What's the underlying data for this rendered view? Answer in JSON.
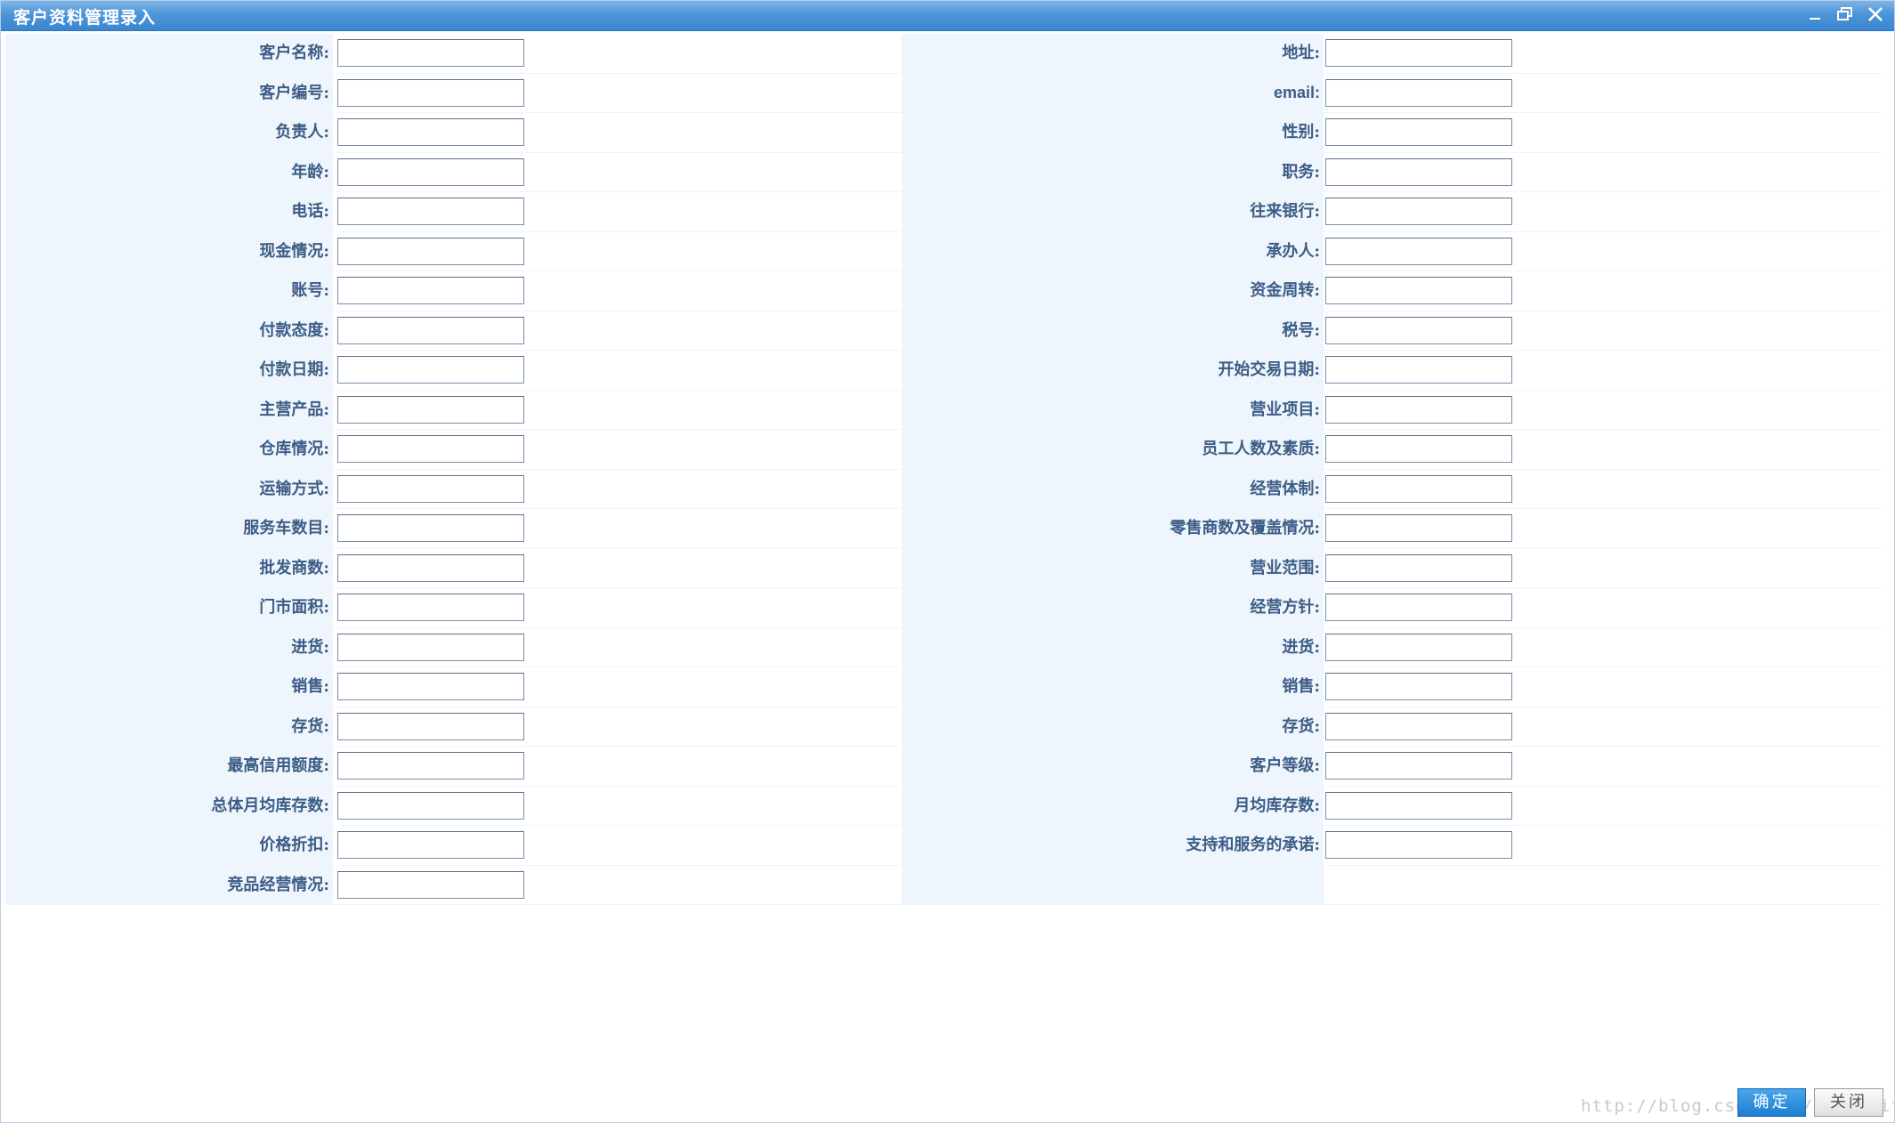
{
  "window": {
    "title": "客户资料管理录入",
    "minimize_icon": "minimize-icon",
    "restore_icon": "restore-icon",
    "close_icon": "close-icon"
  },
  "form": {
    "rows": [
      {
        "left": "客户名称:",
        "right": "地址:"
      },
      {
        "left": "客户编号:",
        "right": "email:"
      },
      {
        "left": "负责人:",
        "right": "性别:"
      },
      {
        "left": "年龄:",
        "right": "职务:"
      },
      {
        "left": "电话:",
        "right": "往来银行:"
      },
      {
        "left": "现金情况:",
        "right": "承办人:"
      },
      {
        "left": "账号:",
        "right": "资金周转:"
      },
      {
        "left": "付款态度:",
        "right": "税号:"
      },
      {
        "left": "付款日期:",
        "right": "开始交易日期:"
      },
      {
        "left": "主营产品:",
        "right": "营业项目:"
      },
      {
        "left": "仓库情况:",
        "right": "员工人数及素质:"
      },
      {
        "left": "运输方式:",
        "right": "经营体制:"
      },
      {
        "left": "服务车数目:",
        "right": "零售商数及覆盖情况:"
      },
      {
        "left": "批发商数:",
        "right": "营业范围:"
      },
      {
        "left": "门市面积:",
        "right": "经营方针:"
      },
      {
        "left": "进货:",
        "right": "进货:"
      },
      {
        "left": "销售:",
        "right": "销售:"
      },
      {
        "left": "存货:",
        "right": "存货:"
      },
      {
        "left": "最高信用额度:",
        "right": "客户等级:"
      },
      {
        "left": "总体月均库存数:",
        "right": "月均库存数:"
      },
      {
        "left": "价格折扣:",
        "right": "支持和服务的承诺:"
      },
      {
        "left": "竞品经营情况:",
        "right": ""
      }
    ]
  },
  "footer": {
    "ok_label": "确定",
    "close_label": "关闭",
    "watermark": "http://blog.csdn.net/ltltalitasaat"
  },
  "colors": {
    "titlebar": "#4e95d8",
    "label_bg": "#eef5fc",
    "label_text": "#3c5d85",
    "ok_button": "#1d7fd2"
  }
}
